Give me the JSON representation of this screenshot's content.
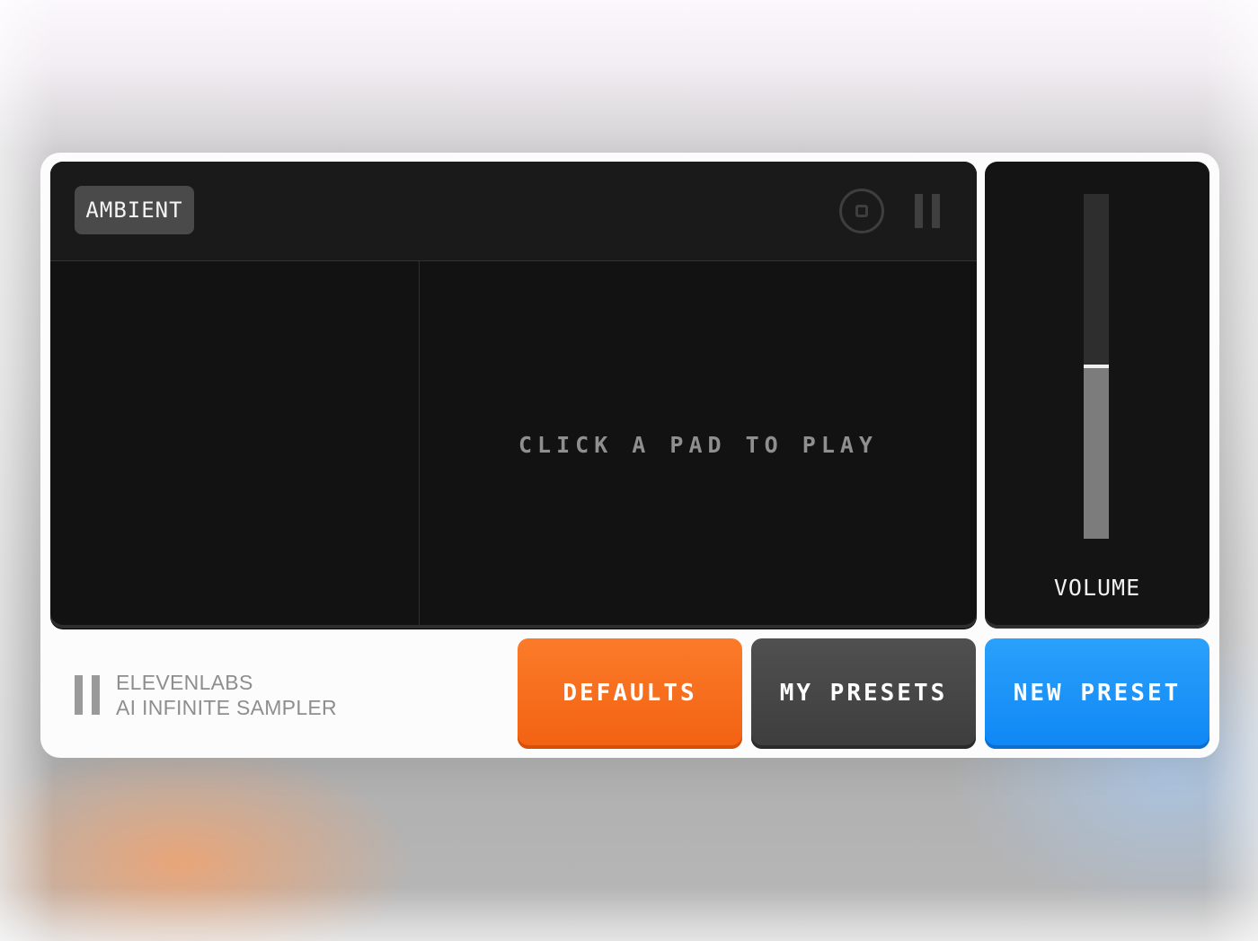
{
  "app": {
    "brand_line1": "ELEVENLABS",
    "brand_line2": "AI INFINITE SAMPLER"
  },
  "display": {
    "category": "AMBIENT",
    "hint": "CLICK A PAD TO PLAY"
  },
  "volume": {
    "label": "VOLUME",
    "level": 0.5
  },
  "buttons": {
    "defaults": "DEFAULTS",
    "my_presets": "MY PRESETS",
    "new_preset": "NEW PRESET"
  },
  "icons": {
    "stop": "stop-icon",
    "pause": "pause-icon",
    "logo": "elevenlabs-logo-icon"
  },
  "colors": {
    "defaults": "#f26a1b",
    "my_presets": "#474747",
    "new_preset": "#1894f8",
    "screen": "#121212"
  }
}
